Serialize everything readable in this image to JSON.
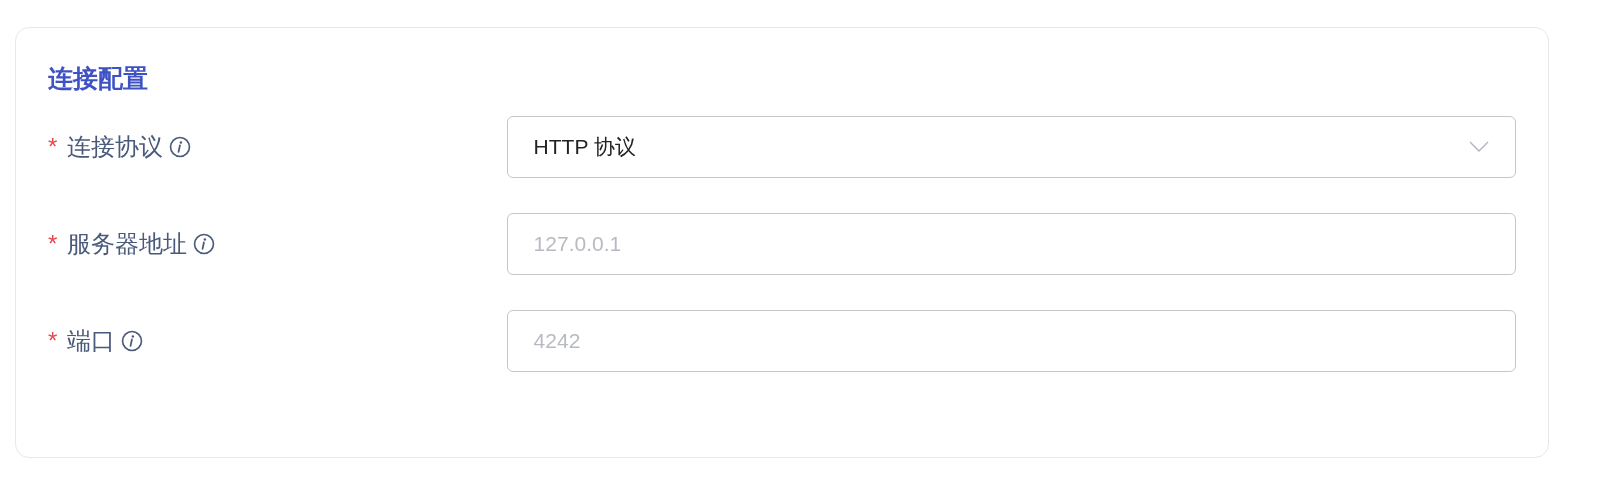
{
  "card": {
    "title": "连接配置",
    "fields": [
      {
        "kind": "select",
        "required_mark": "*",
        "label": "连接协议",
        "value": "HTTP 协议"
      },
      {
        "kind": "input",
        "required_mark": "*",
        "label": "服务器地址",
        "placeholder": "127.0.0.1"
      },
      {
        "kind": "input",
        "required_mark": "*",
        "label": "端口",
        "placeholder": "4242"
      }
    ]
  }
}
